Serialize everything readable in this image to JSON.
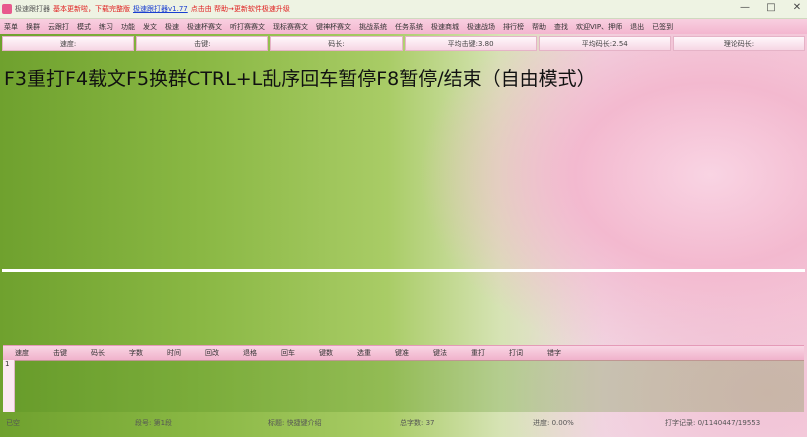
{
  "titlebar": {
    "app_name": "极速跟打器",
    "notice": "基本更新啦，下载完整版",
    "link": "极速跟打器v1.77",
    "hint": "点击由 帮助→更新软件极速升级",
    "buttons": [
      "—",
      "□",
      "✕"
    ]
  },
  "menu": [
    "菜单",
    "换群",
    "云跟打",
    "模式",
    "练习",
    "功能",
    "发文",
    "极速",
    "极速杯赛文",
    "听打赛赛文",
    "现标赛赛文",
    "键神杯赛文",
    "挑战系统",
    "任务系统",
    "极速商城",
    "极速战场",
    "排行榜",
    "帮助",
    "查找",
    "欢迎VIP、押师",
    "退出",
    "已签到"
  ],
  "stats": [
    "速度:",
    "击键:",
    "码长:",
    "平均击键:3.80",
    "平均码长:2.54",
    "理论码长:"
  ],
  "banner": "F3重打F4载文F5换群CTRL+L乱序回车暂停F8暂停/结束（自由模式）",
  "columns": [
    "速度",
    "击键",
    "码长",
    "字数",
    "时间",
    "回改",
    "退格",
    "回车",
    "键数",
    "选重",
    "键准",
    "键法",
    "重打",
    "打词",
    "错字"
  ],
  "grid": {
    "row_label": "1"
  },
  "status": {
    "left": "已空",
    "segment": "段号: 第1段",
    "title": "标题: 快捷键介绍",
    "total": "总字数: 37",
    "progress": "进度: 0.00%",
    "record": "打字记录: 0/1140447/19553"
  },
  "colors": {
    "menu_pink": "#f3b6cf",
    "notice_red": "#e02020",
    "link_blue": "#1a3fd0"
  }
}
